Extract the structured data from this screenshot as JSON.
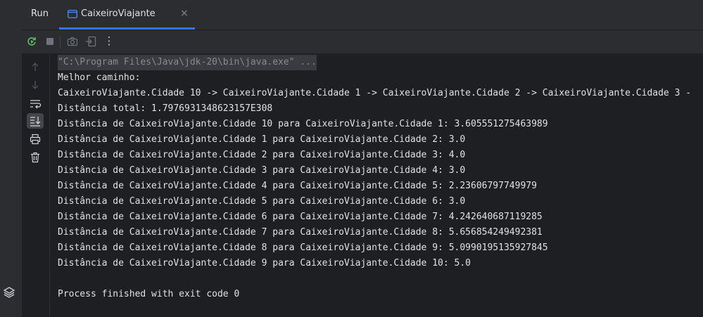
{
  "tool_window": {
    "title": "Run"
  },
  "tabs": [
    {
      "label": "CaixeiroViajante",
      "close": "×"
    }
  ],
  "toolbar": {
    "icons": [
      "rerun-icon",
      "stop-icon",
      "camera-icon",
      "restore-layout-icon",
      "more-icon"
    ],
    "more_glyph": "⋮"
  },
  "console": {
    "command": "\"C:\\Program Files\\Java\\jdk-20\\bin\\java.exe\" ...",
    "lines": [
      "Melhor caminho:",
      "CaixeiroViajante.Cidade 10 -> CaixeiroViajante.Cidade 1 -> CaixeiroViajante.Cidade 2 -> CaixeiroViajante.Cidade 3 -",
      "Distância total: 1.7976931348623157E308",
      "Distância de CaixeiroViajante.Cidade 10 para CaixeiroViajante.Cidade 1: 3.605551275463989",
      "Distância de CaixeiroViajante.Cidade 1 para CaixeiroViajante.Cidade 2: 3.0",
      "Distância de CaixeiroViajante.Cidade 2 para CaixeiroViajante.Cidade 3: 4.0",
      "Distância de CaixeiroViajante.Cidade 3 para CaixeiroViajante.Cidade 4: 3.0",
      "Distância de CaixeiroViajante.Cidade 4 para CaixeiroViajante.Cidade 5: 2.23606797749979",
      "Distância de CaixeiroViajante.Cidade 5 para CaixeiroViajante.Cidade 6: 3.0",
      "Distância de CaixeiroViajante.Cidade 6 para CaixeiroViajante.Cidade 7: 4.242640687119285",
      "Distância de CaixeiroViajante.Cidade 7 para CaixeiroViajante.Cidade 8: 5.656854249492381",
      "Distância de CaixeiroViajante.Cidade 8 para CaixeiroViajante.Cidade 9: 5.0990195135927845",
      "Distância de CaixeiroViajante.Cidade 9 para CaixeiroViajante.Cidade 10: 5.0",
      "",
      "Process finished with exit code 0"
    ]
  },
  "colors": {
    "accent": "#3574f0",
    "rerun": "#5fb865",
    "background": "#1e1f22",
    "panel": "#2b2d30"
  }
}
